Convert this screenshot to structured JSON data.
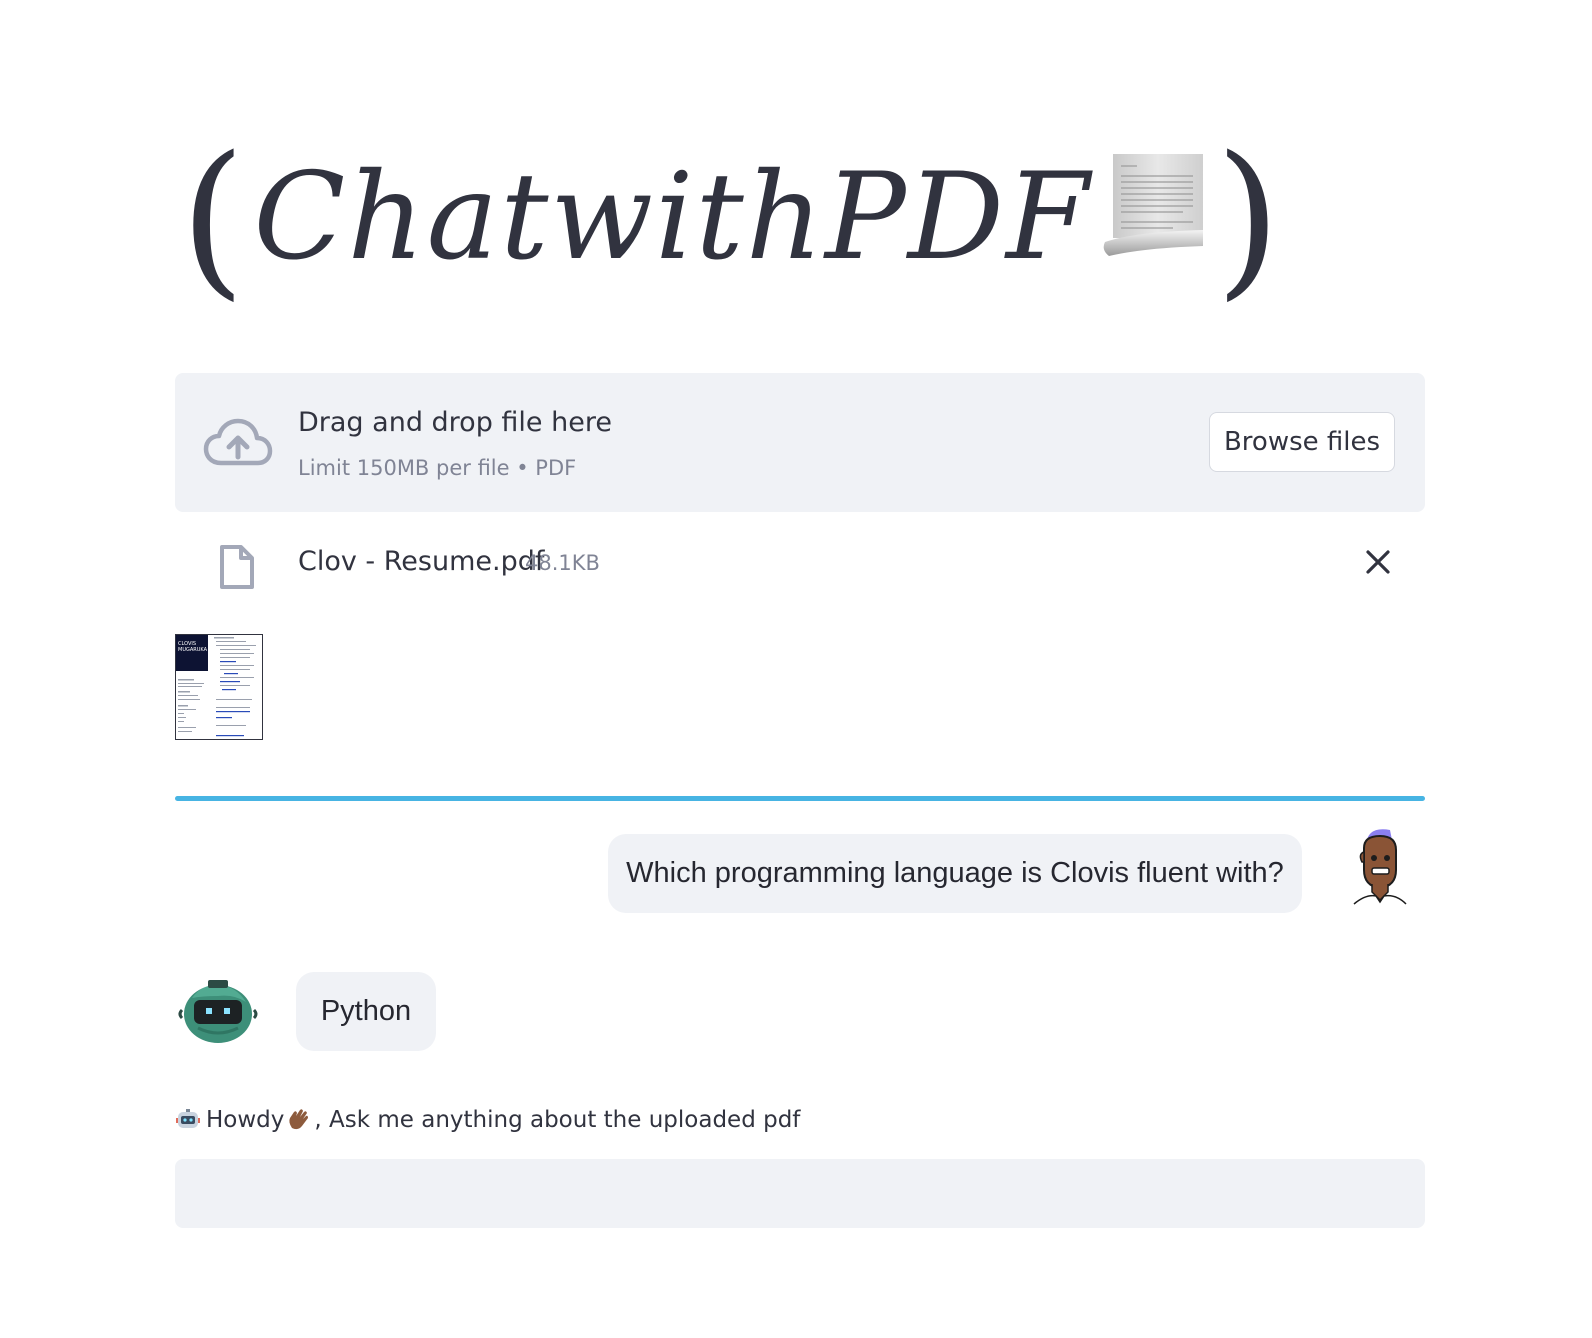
{
  "title": {
    "open_paren": "(",
    "text": "ChatwithPDF",
    "close_paren": ")",
    "scroll_icon": "scroll-icon"
  },
  "uploader": {
    "drop_title": "Drag and drop file here",
    "drop_subtitle": "Limit 150MB per file • PDF",
    "browse_label": "Browse files",
    "cloud_icon": "cloud-upload-icon"
  },
  "file": {
    "name": "Clov - Resume.pdf",
    "size": "48.1KB",
    "icon": "file-icon",
    "remove_icon": "close-icon"
  },
  "thumbnail": {
    "header_name": "CLOVIS\nMUGARUKA"
  },
  "colors": {
    "divider": "#47b4e3",
    "surface": "#f0f2f6",
    "text": "#31333f",
    "muted": "#808495"
  },
  "chat": {
    "messages": [
      {
        "role": "user",
        "text": "Which programming language is Clovis fluent with?",
        "avatar": "user-avatar-icon"
      },
      {
        "role": "assistant",
        "text": "Python",
        "avatar": "robot-avatar-icon"
      }
    ]
  },
  "input": {
    "label_text": "Howdy",
    "label_rest": ", Ask me anything about the uploaded pdf",
    "value": "",
    "placeholder": ""
  }
}
